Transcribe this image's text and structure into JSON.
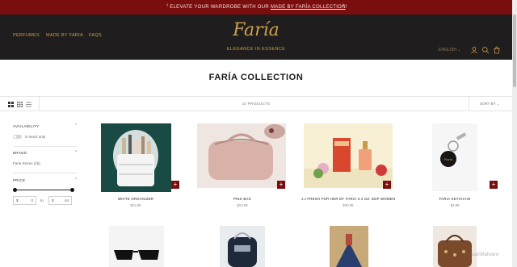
{
  "announcement": {
    "text_before": "ELEVATE YOUR WARDROBE WITH OUR ",
    "link": "MADE BY FARÍA COLLECTION",
    "text_after": "!",
    "prev_icon": "chevron-left-icon",
    "next_icon": "chevron-right-icon"
  },
  "header": {
    "nav": [
      "PERFUMES",
      "MADE BY FARIA",
      "FAQS"
    ],
    "logo": "Faría",
    "tagline": "ELEGANCE IN ESSENCE",
    "language": "ENGLISH",
    "icons": [
      "account-icon",
      "search-icon",
      "cart-icon"
    ],
    "accent": "#c9a14a",
    "bar_color": "#7a0d0d"
  },
  "page": {
    "title": "FARÍA COLLECTION"
  },
  "toolbar": {
    "product_count": "10 PRODUCTS",
    "sort_label": "SORT BY"
  },
  "filters": {
    "availability": {
      "label": "AVAILABILITY",
      "option": "In stock only"
    },
    "brand": {
      "label": "BRAND",
      "option": "Faria Stores (15)"
    },
    "price": {
      "label": "PRICE",
      "min_symbol": "$",
      "min": "0",
      "to": "to",
      "max_symbol": "$",
      "max": "44"
    }
  },
  "products": [
    {
      "name": "WHITE ORGANIZER",
      "price": "$22.99"
    },
    {
      "name": "PINK BAG",
      "price": "$10.99"
    },
    {
      "name": "J.J FRESH FOR HER BY FARIA 3.4 OZ. EDP WOMEN",
      "price": "$30.99"
    },
    {
      "name": "FARIA KEYCHAIN",
      "price": "$4.99"
    }
  ],
  "watermark": "scanMalware"
}
